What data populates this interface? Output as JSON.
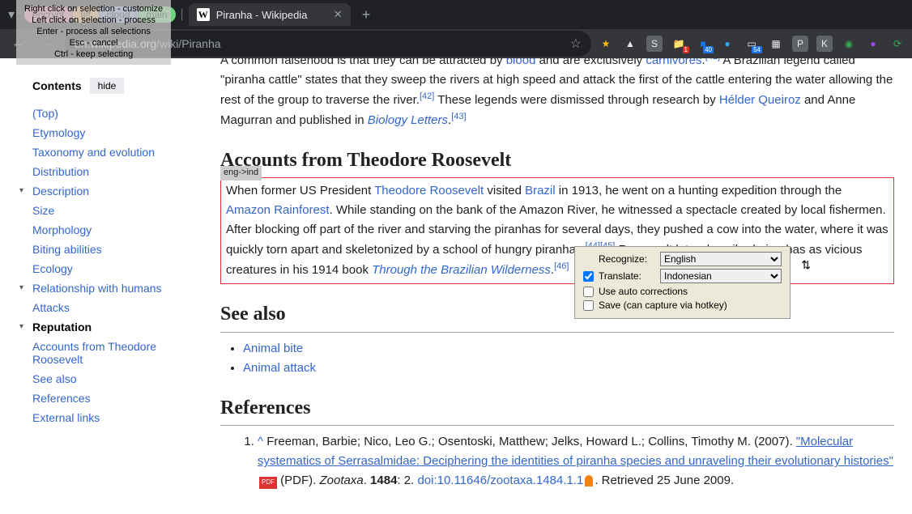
{
  "tooltip": {
    "line1": "Right click on selection - customize",
    "line2": "Left click on selection - process",
    "line3": "Enter - process all selections",
    "line4": "Esc - cancel",
    "line5": "Ctrl - keep selecting"
  },
  "pill_tabs": [
    {
      "label": "encrypt",
      "bg": "#f28ab2"
    },
    {
      "label": "tiff",
      "bg": "#f7b267"
    },
    {
      "label": "cloud",
      "bg": "#8fa1d0"
    },
    {
      "label": "main",
      "bg": "#6dd67d"
    }
  ],
  "active_tab": {
    "title": "Piranha - Wikipedia"
  },
  "url": {
    "prefix": "en.wikipedia.org",
    "path": "/wiki/Piranha"
  },
  "ext_icons": [
    {
      "name": "fav-icon",
      "glyph": "★",
      "color": "#fbbc04"
    },
    {
      "name": "cloud-icon",
      "glyph": "▲",
      "color": "#e8eaed"
    },
    {
      "name": "s-icon",
      "glyph": "S",
      "color": "#e8eaed",
      "bg": "#5f6368"
    },
    {
      "name": "folder-badge",
      "glyph": "📁",
      "color": "#fbbc04",
      "badge": "1",
      "badge_bg": "#d93025"
    },
    {
      "name": "box-badge",
      "glyph": "■",
      "color": "#1a73e8",
      "badge": "40"
    },
    {
      "name": "orb-icon",
      "glyph": "●",
      "color": "#34a8eb"
    },
    {
      "name": "doc-badge",
      "glyph": "▭",
      "color": "#e8eaed",
      "badge": "54"
    },
    {
      "name": "grid-icon",
      "glyph": "▦",
      "color": "#e8eaed"
    },
    {
      "name": "pm-icon",
      "glyph": "P",
      "color": "#e8eaed",
      "bg": "#5f6368"
    },
    {
      "name": "k-icon",
      "glyph": "K",
      "color": "#e8eaed",
      "bg": "#5f6368"
    },
    {
      "name": "globe-icon",
      "glyph": "◉",
      "color": "#34a853"
    },
    {
      "name": "purple-icon",
      "glyph": "●",
      "color": "#a142f4"
    },
    {
      "name": "refresh-icon",
      "glyph": "⟳",
      "color": "#34a853"
    }
  ],
  "sidebar": {
    "title": "Contents",
    "hide": "hide",
    "items": [
      {
        "label": "(Top)"
      },
      {
        "label": "Etymology"
      },
      {
        "label": "Taxonomy and evolution"
      },
      {
        "label": "Distribution"
      },
      {
        "label": "Description",
        "chev": true
      },
      {
        "label": "Size",
        "sub": true
      },
      {
        "label": "Morphology",
        "sub": true
      },
      {
        "label": "Biting abilities",
        "sub": true
      },
      {
        "label": "Ecology"
      },
      {
        "label": "Relationship with humans",
        "chev": true
      },
      {
        "label": "Attacks",
        "sub": true
      },
      {
        "label": "Reputation",
        "chev": true,
        "bold": true
      },
      {
        "label": "Accounts from Theodore Roosevelt",
        "sub": true
      },
      {
        "label": "See also"
      },
      {
        "label": "References"
      },
      {
        "label": "External links"
      }
    ]
  },
  "article": {
    "p1_a": "A common falsehood is that they can be attracted by ",
    "p1_link1": "blood",
    "p1_b": " and are exclusively ",
    "p1_link2": "carnivores",
    "p1_c": ".",
    "p1_d": " A Brazilian legend called \"piranha cattle\" states that they sweep the rivers at high speed and attack the first of the cattle entering the water allowing the rest of the group to traverse the river.",
    "p1_sup1": "[42]",
    "p1_e": " These legends were dismissed through research by ",
    "p1_link3": "Hélder Queiroz",
    "p1_f": " and Anne Magurran and published in ",
    "p1_link4": "Biology Letters",
    "p1_g": ".",
    "p1_sup2": "[43]",
    "h2_roosevelt": "Accounts from Theodore Roosevelt",
    "sel_label": "eng->ind",
    "p2_a": "When former US President ",
    "p2_l1": "Theodore Roosevelt",
    "p2_b": " visited ",
    "p2_l2": "Brazil",
    "p2_c": " in 1913, he went on a hunting expedition through the ",
    "p2_l3": "Amazon Rainforest",
    "p2_d": ". While standing on the bank of the Amazon River, he witnessed a spectacle created by local fishermen. After blocking off part of the river and starving the piranhas for several days, they pushed a cow into the water, where it was quickly torn apart and skeletonized by a school of hungry piranhas.",
    "p2_sup1": "[44]",
    "p2_sup2": "[45]",
    "p2_e": " Roosevelt later described piranhas as vicious creatures in his 1914 book ",
    "p2_l4": "Through the Brazilian Wilderness",
    "p2_f": ".",
    "p2_sup3": "[46]",
    "h2_see": "See also",
    "see_also": [
      "Animal bite",
      "Animal attack"
    ],
    "h2_ref": "References",
    "ref1": {
      "caret": "^",
      "a": " Freeman, Barbie; Nico, Leo G.; Osentoski, Matthew; Jelks, Howard L.; Collins, Timothy M. (2007). ",
      "title": "\"Molecular systematics of Serrasalmidae: Deciphering the identities of piranha species and unraveling their evolutionary histories\"",
      "pdf": "PDF",
      "b": " (PDF). ",
      "journal": "Zootaxa",
      "c": ". ",
      "vol": "1484",
      "d": ": 2. ",
      "doi": "doi:10.11646/zootaxa.1484.1.1",
      "e": ". Retrieved 25 June 2009."
    }
  },
  "translate_panel": {
    "recognize_label": "Recognize:",
    "recognize_value": "English",
    "translate_label": "Translate:",
    "translate_value": "Indonesian",
    "auto": "Use auto corrections",
    "save": "Save (can capture via hotkey)"
  }
}
